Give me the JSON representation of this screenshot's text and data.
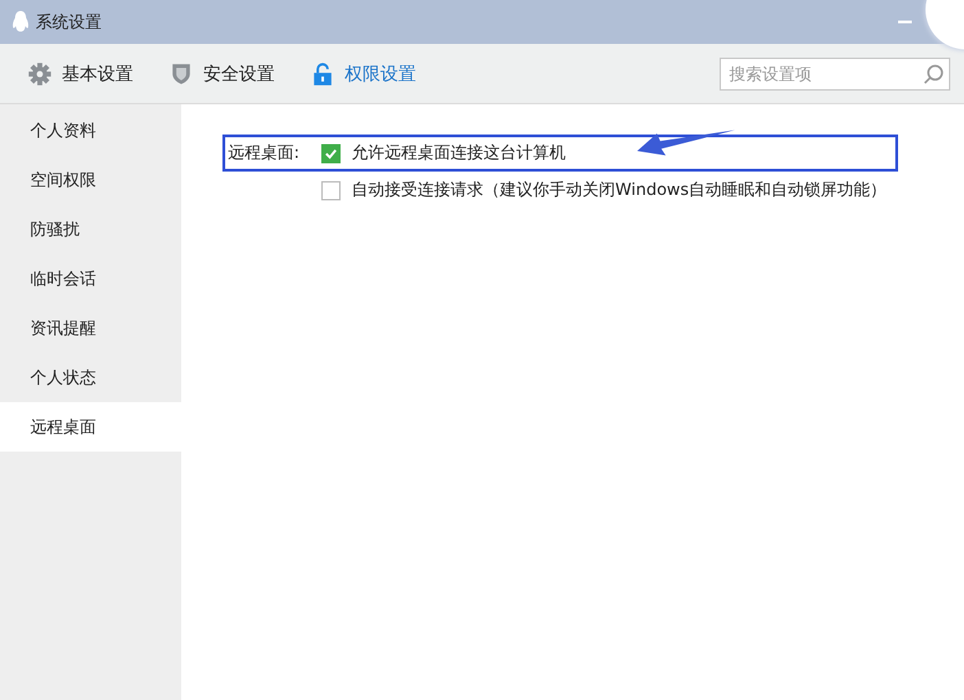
{
  "window": {
    "title": "系统设置"
  },
  "tabs": [
    {
      "label": "基本设置",
      "kind": "gear",
      "selected": false
    },
    {
      "label": "安全设置",
      "kind": "shield",
      "selected": false
    },
    {
      "label": "权限设置",
      "kind": "lock",
      "selected": true
    }
  ],
  "search": {
    "placeholder": "搜索设置项"
  },
  "sidebar": {
    "items": [
      {
        "label": "个人资料",
        "selected": false
      },
      {
        "label": "空间权限",
        "selected": false
      },
      {
        "label": "防骚扰",
        "selected": false
      },
      {
        "label": "临时会话",
        "selected": false
      },
      {
        "label": "资讯提醒",
        "selected": false
      },
      {
        "label": "个人状态",
        "selected": false
      },
      {
        "label": "远程桌面",
        "selected": true
      }
    ]
  },
  "section": {
    "label": "远程桌面:",
    "options": [
      {
        "label": "允许远程桌面连接这台计算机",
        "checked": true
      },
      {
        "label": "自动接受连接请求（建议你手动关闭Windows自动睡眠和自动锁屏功能）",
        "checked": false
      }
    ]
  }
}
